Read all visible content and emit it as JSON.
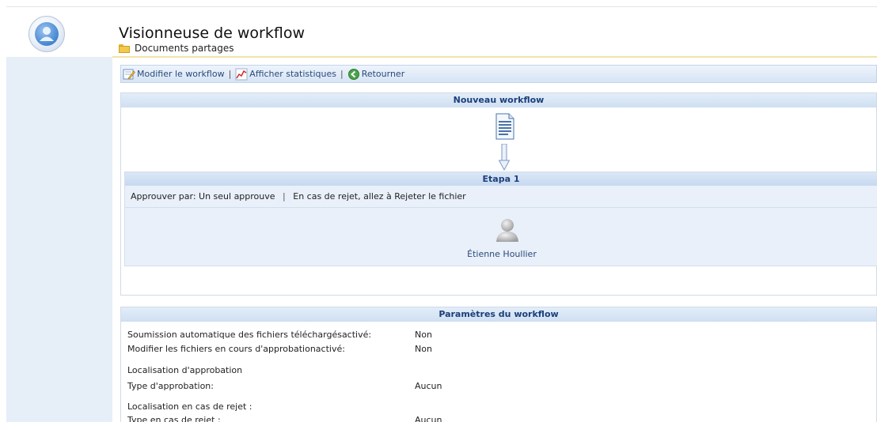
{
  "header": {
    "title": "Visionneuse de workflow",
    "breadcrumb": "Documents partages"
  },
  "toolbar": {
    "edit_label": "Modifier le workflow",
    "stats_label": "Afficher statistiques",
    "back_label": "Retourner",
    "separator": "|"
  },
  "workflow": {
    "title": "Nouveau workflow",
    "step": {
      "title": "Etapa 1",
      "approve_by": "Approuver par: Un seul approuve",
      "separator": "|",
      "on_reject": "En cas de rejet, allez à Rejeter le fichier",
      "user_name": "Étienne Houllier"
    }
  },
  "params": {
    "title": "Paramètres du workflow",
    "rows": [
      {
        "label": "Soumission automatique des fichiers téléchargésactivé:",
        "value": "Non"
      },
      {
        "label": "Modifier les fichiers en cours d'approbationactivé:",
        "value": "Non"
      },
      {
        "label": "Localisation d'approbation",
        "value": ""
      },
      {
        "label": "Type d'approbation:",
        "value": "Aucun"
      },
      {
        "label": "Localisation en cas de rejet :",
        "value": ""
      },
      {
        "label": "Type en cas de rejet :",
        "value": "Aucun"
      }
    ]
  },
  "icons": {
    "logo": "users-logo-icon",
    "folder": "folder-icon",
    "edit": "edit-workflow-icon",
    "stats": "chart-icon",
    "back": "back-icon",
    "document": "document-icon",
    "arrow": "arrow-down-icon",
    "user": "user-icon"
  }
}
